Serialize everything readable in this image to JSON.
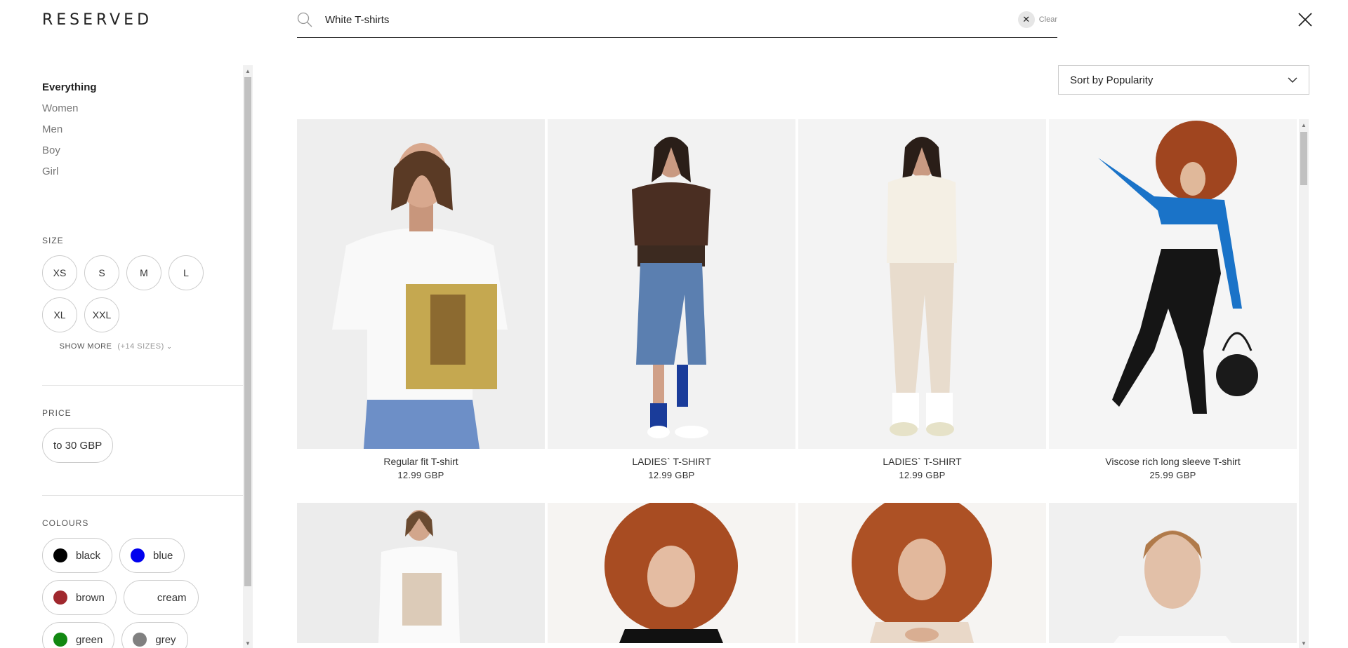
{
  "brand": {
    "logo": "RESERVED"
  },
  "search": {
    "value": "White T-shirts",
    "clear_label": "Clear"
  },
  "sidebar": {
    "categories": [
      "Everything",
      "Women",
      "Men",
      "Boy",
      "Girl"
    ],
    "active_category": "Everything",
    "size": {
      "title": "SIZE",
      "options": [
        "XS",
        "S",
        "M",
        "L",
        "XL",
        "XXL"
      ],
      "show_more": "SHOW MORE",
      "show_more_count": "(+14 SIZES)"
    },
    "price": {
      "title": "PRICE",
      "options": [
        "to 30 GBP"
      ]
    },
    "colours": {
      "title": "COLOURS",
      "options": [
        {
          "label": "black",
          "color": "#000000"
        },
        {
          "label": "blue",
          "color": "#0000ee"
        },
        {
          "label": "brown",
          "color": "#a0282e"
        },
        {
          "label": "cream",
          "color": ""
        },
        {
          "label": "green",
          "color": "#118811"
        },
        {
          "label": "grey",
          "color": "#808080"
        }
      ]
    }
  },
  "sort": {
    "label": "Sort by Popularity"
  },
  "products": [
    {
      "name": "Regular fit T-shirt",
      "price": "12.99 GBP"
    },
    {
      "name": "LADIES` T-SHIRT",
      "price": "12.99 GBP"
    },
    {
      "name": "LADIES` T-SHIRT",
      "price": "12.99 GBP"
    },
    {
      "name": "Viscose rich long sleeve T-shirt",
      "price": "25.99 GBP"
    },
    {
      "name": "",
      "price": ""
    },
    {
      "name": "",
      "price": ""
    },
    {
      "name": "",
      "price": ""
    },
    {
      "name": "",
      "price": ""
    }
  ]
}
